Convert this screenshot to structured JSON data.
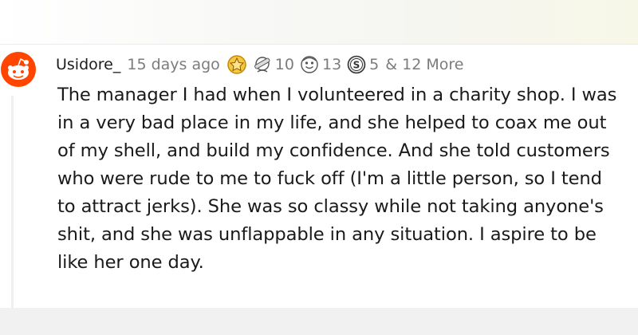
{
  "comment": {
    "username": "Usidore_",
    "time_ago": "15 days ago",
    "awards": [
      {
        "icon": "gold-award-icon",
        "count": ""
      },
      {
        "icon": "bandaged-award-icon",
        "count": "10"
      },
      {
        "icon": "wholesome-face-award-icon",
        "count": "13"
      },
      {
        "icon": "silver-coin-award-icon",
        "count": "5"
      }
    ],
    "more_label": "& 12 More",
    "body": "The manager I had when I volunteered in a charity shop. I was in a very bad place in my life, and she helped to coax me out of my shell, and build my confidence. And she told customers who were rude to me to fuck off (I'm a little person, so I tend to attract jerks). She was so classy while not taking anyone's shit, and she was unflappable in any situation. I aspire to be like her one day."
  },
  "colors": {
    "avatar_orange": "#ff4500",
    "text": "#1a1a1b",
    "meta": "#7c7c7c"
  }
}
